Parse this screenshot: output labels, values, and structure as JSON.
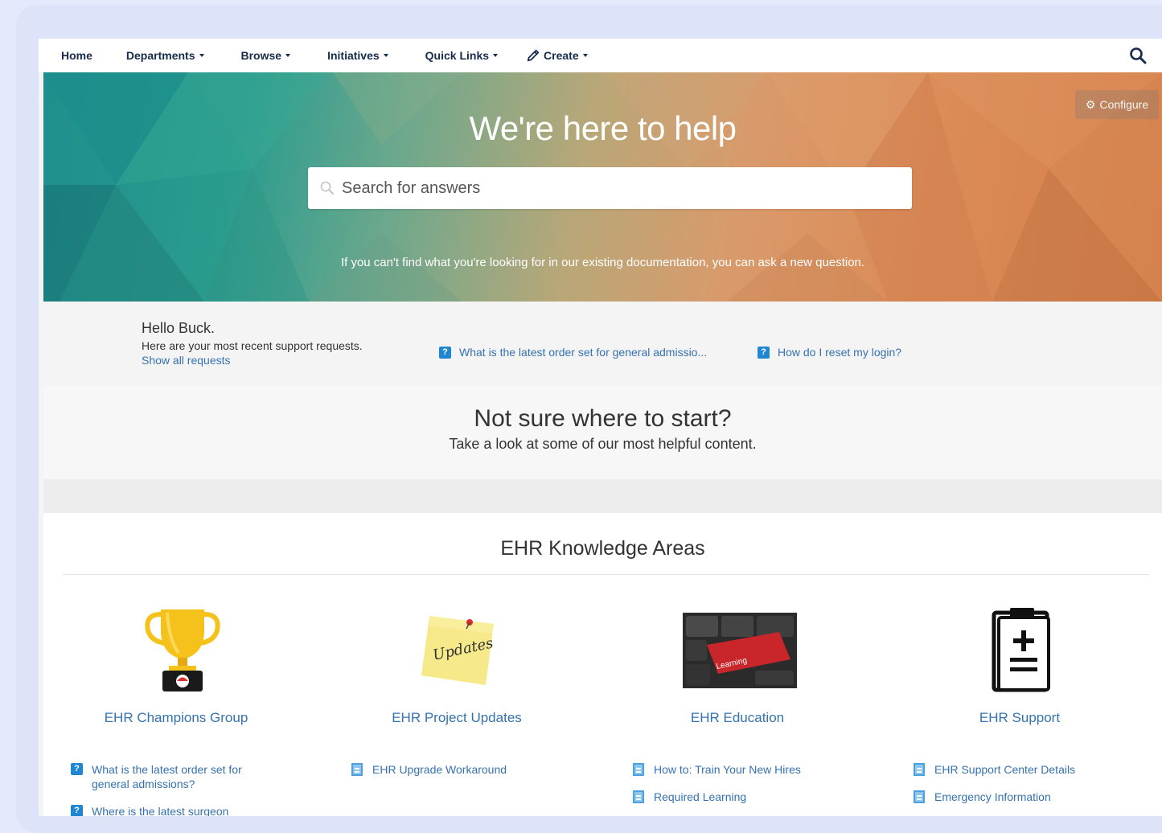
{
  "nav": {
    "home": "Home",
    "departments": "Departments",
    "browse": "Browse",
    "initiatives": "Initiatives",
    "quick_links": "Quick Links",
    "create": "Create"
  },
  "banner": {
    "title": "We're here to help",
    "search_placeholder": "Search for answers",
    "hint": "If you can't find what you're looking for in our existing documentation, you can ask a new question.",
    "configure_label": "Configure"
  },
  "greeting": {
    "hello": "Hello Buck.",
    "subtitle": "Here are your most recent support requests.",
    "show_all": "Show all requests",
    "recent": [
      "What is the latest order set for general admissio...",
      "How do I reset my login?"
    ]
  },
  "not_sure": {
    "heading": "Not sure where to start?",
    "subheading": "Take a look at some of our most helpful content."
  },
  "knowledge": {
    "heading": "EHR Knowledge Areas",
    "areas": [
      {
        "title": "EHR Champions Group",
        "image": "trophy-icon",
        "links": [
          "What is the latest order set for general admissions?",
          "Where is the latest surgeon"
        ]
      },
      {
        "title": "EHR Project Updates",
        "image": "sticky-note-updates",
        "image_text": "Updates",
        "links": [
          "EHR Upgrade Workaround"
        ]
      },
      {
        "title": "EHR Education",
        "image": "keyboard-learning-key",
        "image_text": "Learning",
        "links": [
          "How to: Train Your New Hires",
          "Required Learning"
        ]
      },
      {
        "title": "EHR Support",
        "image": "clipboard-icon",
        "links": [
          "EHR Support Center Details",
          "Emergency Information"
        ]
      }
    ]
  }
}
